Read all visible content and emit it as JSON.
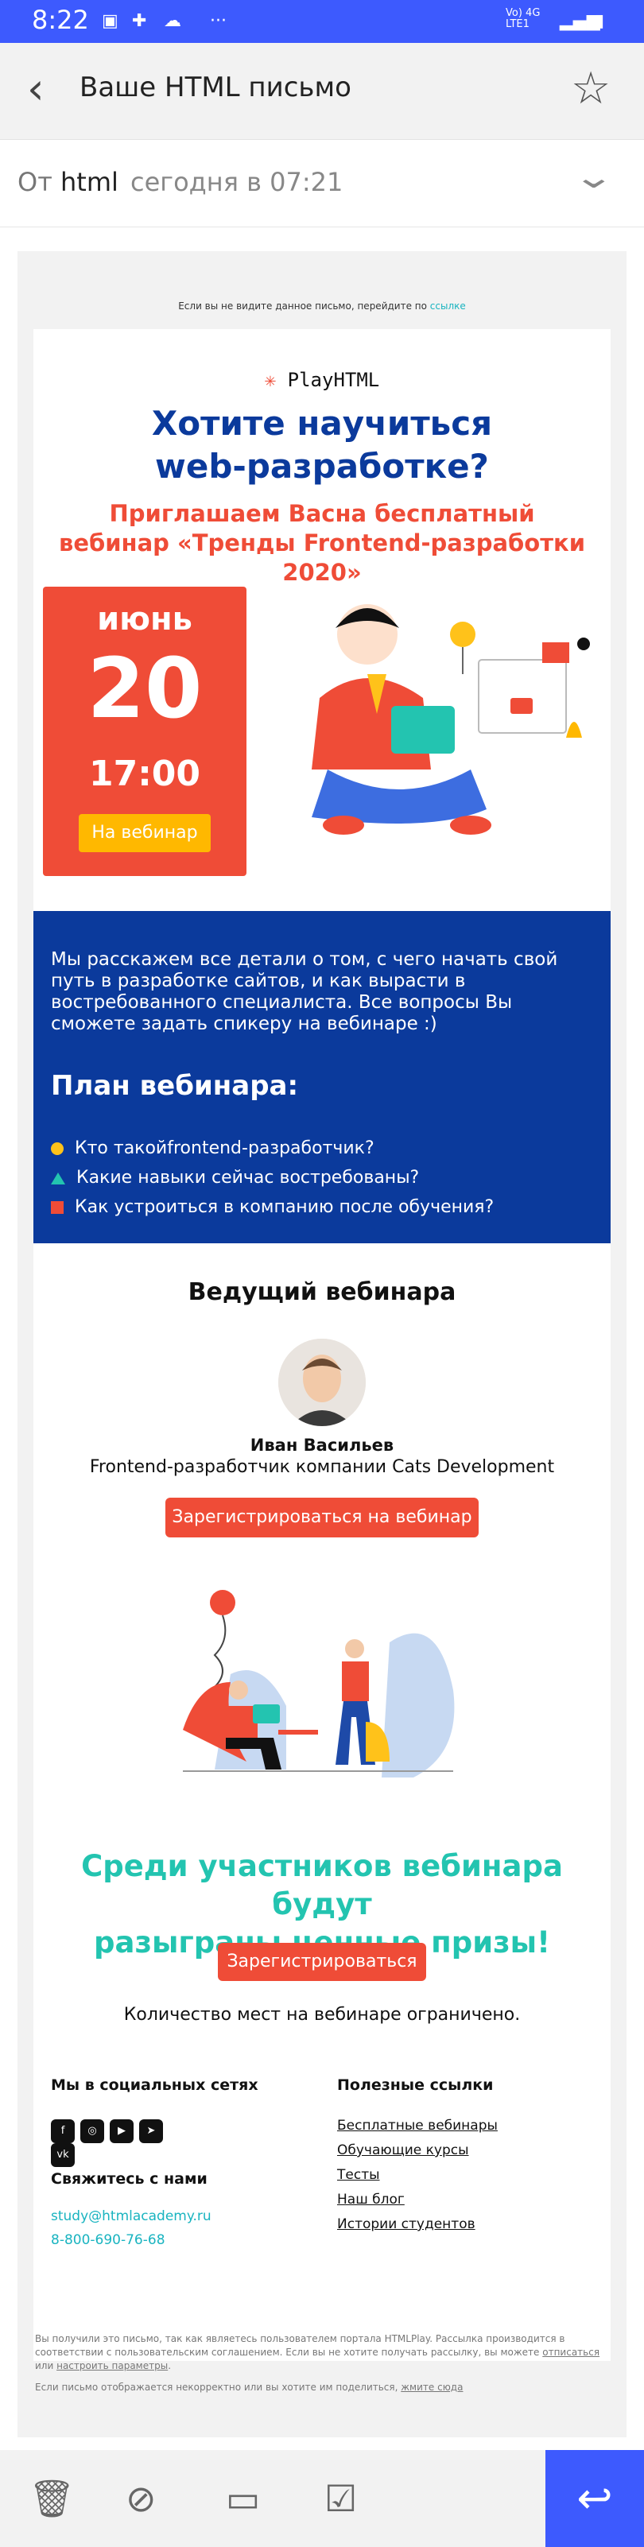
{
  "status": {
    "time": "8:22",
    "dots": "···",
    "net_top": "Vo)  4G",
    "net_bottom": "LTE1"
  },
  "header": {
    "title": "Ваше HTML письмо"
  },
  "meta": {
    "from_label": "От",
    "from_value": "html",
    "date": "сегодня в 07:21"
  },
  "email": {
    "preheader": "Если вы не видите данное письмо, перейдите по ",
    "preheader_link": "ссылке",
    "logo": "PlayHTML",
    "headline1": "Хотите научиться",
    "headline2": "web-разработке?",
    "invite1": "Приглашаем Васна бесплатный",
    "invite2": "вебинар «Тренды Frontend-разработки 2020»",
    "month": "июнь",
    "day": "20",
    "time": "17:00",
    "date_button": "На вебинар",
    "about": "Мы расскажем все детали о том, с чего начать свой путь в разработке сайтов, и как вырасти в востребованного специалиста. Все вопросы Вы сможете задать спикеру на вебинаре :)",
    "plan_title": "План вебинара:",
    "plan": [
      "Кто такойfrontend-разработчик?",
      "Какие навыки сейчас востребованы?",
      "Как устроиться в компанию после обучения?"
    ],
    "speaker_title": "Ведущий вебинара",
    "speaker_name": "Иван Васильев",
    "speaker_role": "Frontend-разработчик компании Cats Development",
    "register_button": "Зарегистрироваться на вебинар",
    "prize1": "Среди участников вебинара будут",
    "prize2": "разыграны ценные призы!",
    "register_button2": "Зарегистрироваться",
    "limit": "Количество мест на вебинаре ограничено.",
    "social_title": "Мы в социальных сетях",
    "social": [
      "f",
      "◎",
      "▶",
      "➤",
      "vk"
    ],
    "contact_title": "Свяжитесь с нами",
    "email_addr": "study@htmlacademy.ru",
    "phone": "8-800-690-76-68",
    "links_title": "Полезные ссылки",
    "links": [
      "Бесплатные вебинары",
      "Обучающие курсы",
      "Тесты",
      "Наш блог",
      "Истории студентов"
    ],
    "legal1": "Вы получили это письмо, так как являетесь пользователем портала HTMLPlay. Рассылка производится в соответствии с пользовательским соглашением. Если вы не хотите получать рассылку, вы можете ",
    "unsub": "отписаться",
    "legal_or": " или ",
    "settings": "настроить параметры",
    "legal_dot": ".",
    "legal2": "Если письмо отображается некорректно или вы хотите им поделиться, ",
    "legal2_link": "жмите сюда",
    "colors": {
      "accent": "#3d5afe",
      "blue": "#0b3a9c",
      "red": "#ef4c37",
      "teal": "#23c4b0",
      "yellow": "#ffb800"
    }
  }
}
